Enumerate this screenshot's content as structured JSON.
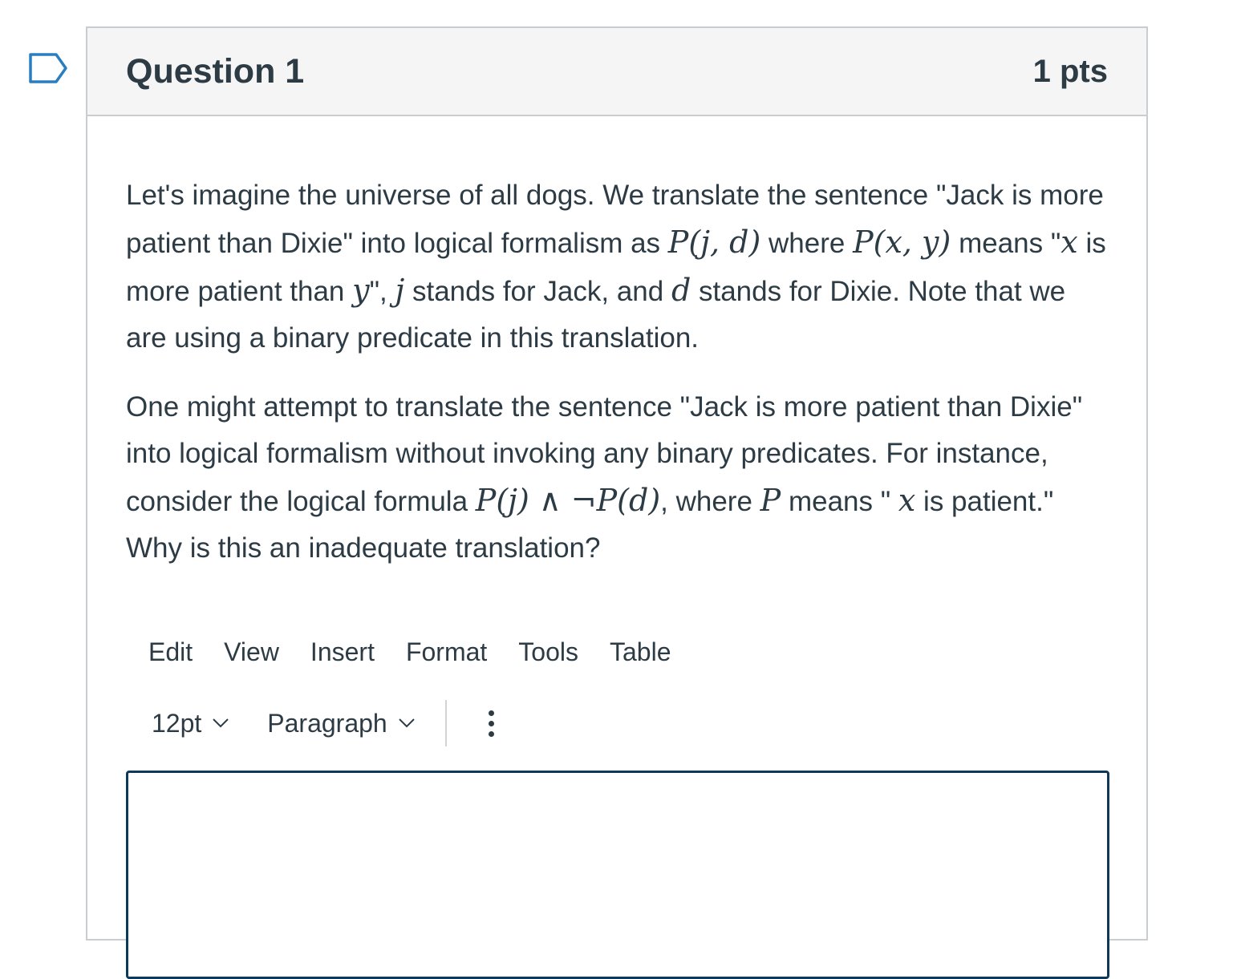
{
  "question": {
    "title": "Question 1",
    "points": "1 pts",
    "paragraph1": {
      "t1": "Let's imagine the universe of all dogs. We translate the sentence \"Jack is more patient than Dixie\" into logical formalism as ",
      "m1": "P(j, d)",
      "t2": " where ",
      "m2": "P(x, y)",
      "t3": " means \"",
      "m3": "x",
      "t4": " is more patient than ",
      "m4": "y",
      "t5": "\", ",
      "m5": "j",
      "t6": " stands for Jack, and ",
      "m6": "d",
      "t7": " stands for Dixie. Note that we are using a binary predicate in this translation."
    },
    "paragraph2": {
      "t1": "One might attempt to translate the sentence \"Jack is more patient than Dixie\" into logical formalism without invoking any binary predicates. For instance, consider the logical formula ",
      "m1": "P(j) ∧ ¬P(d)",
      "t2": ", where ",
      "m2": "P",
      "t3": " means \" ",
      "m3": "x",
      "t4": " is patient.\" Why is this an inadequate translation?"
    }
  },
  "editor": {
    "menu": [
      "Edit",
      "View",
      "Insert",
      "Format",
      "Tools",
      "Table"
    ],
    "font_size": "12pt",
    "block_format": "Paragraph",
    "border_color": "#0e3a5a"
  },
  "icons": {
    "flag": "bookmark-flag-icon",
    "chevron": "chevron-down-icon",
    "more": "more-vertical-icon"
  }
}
